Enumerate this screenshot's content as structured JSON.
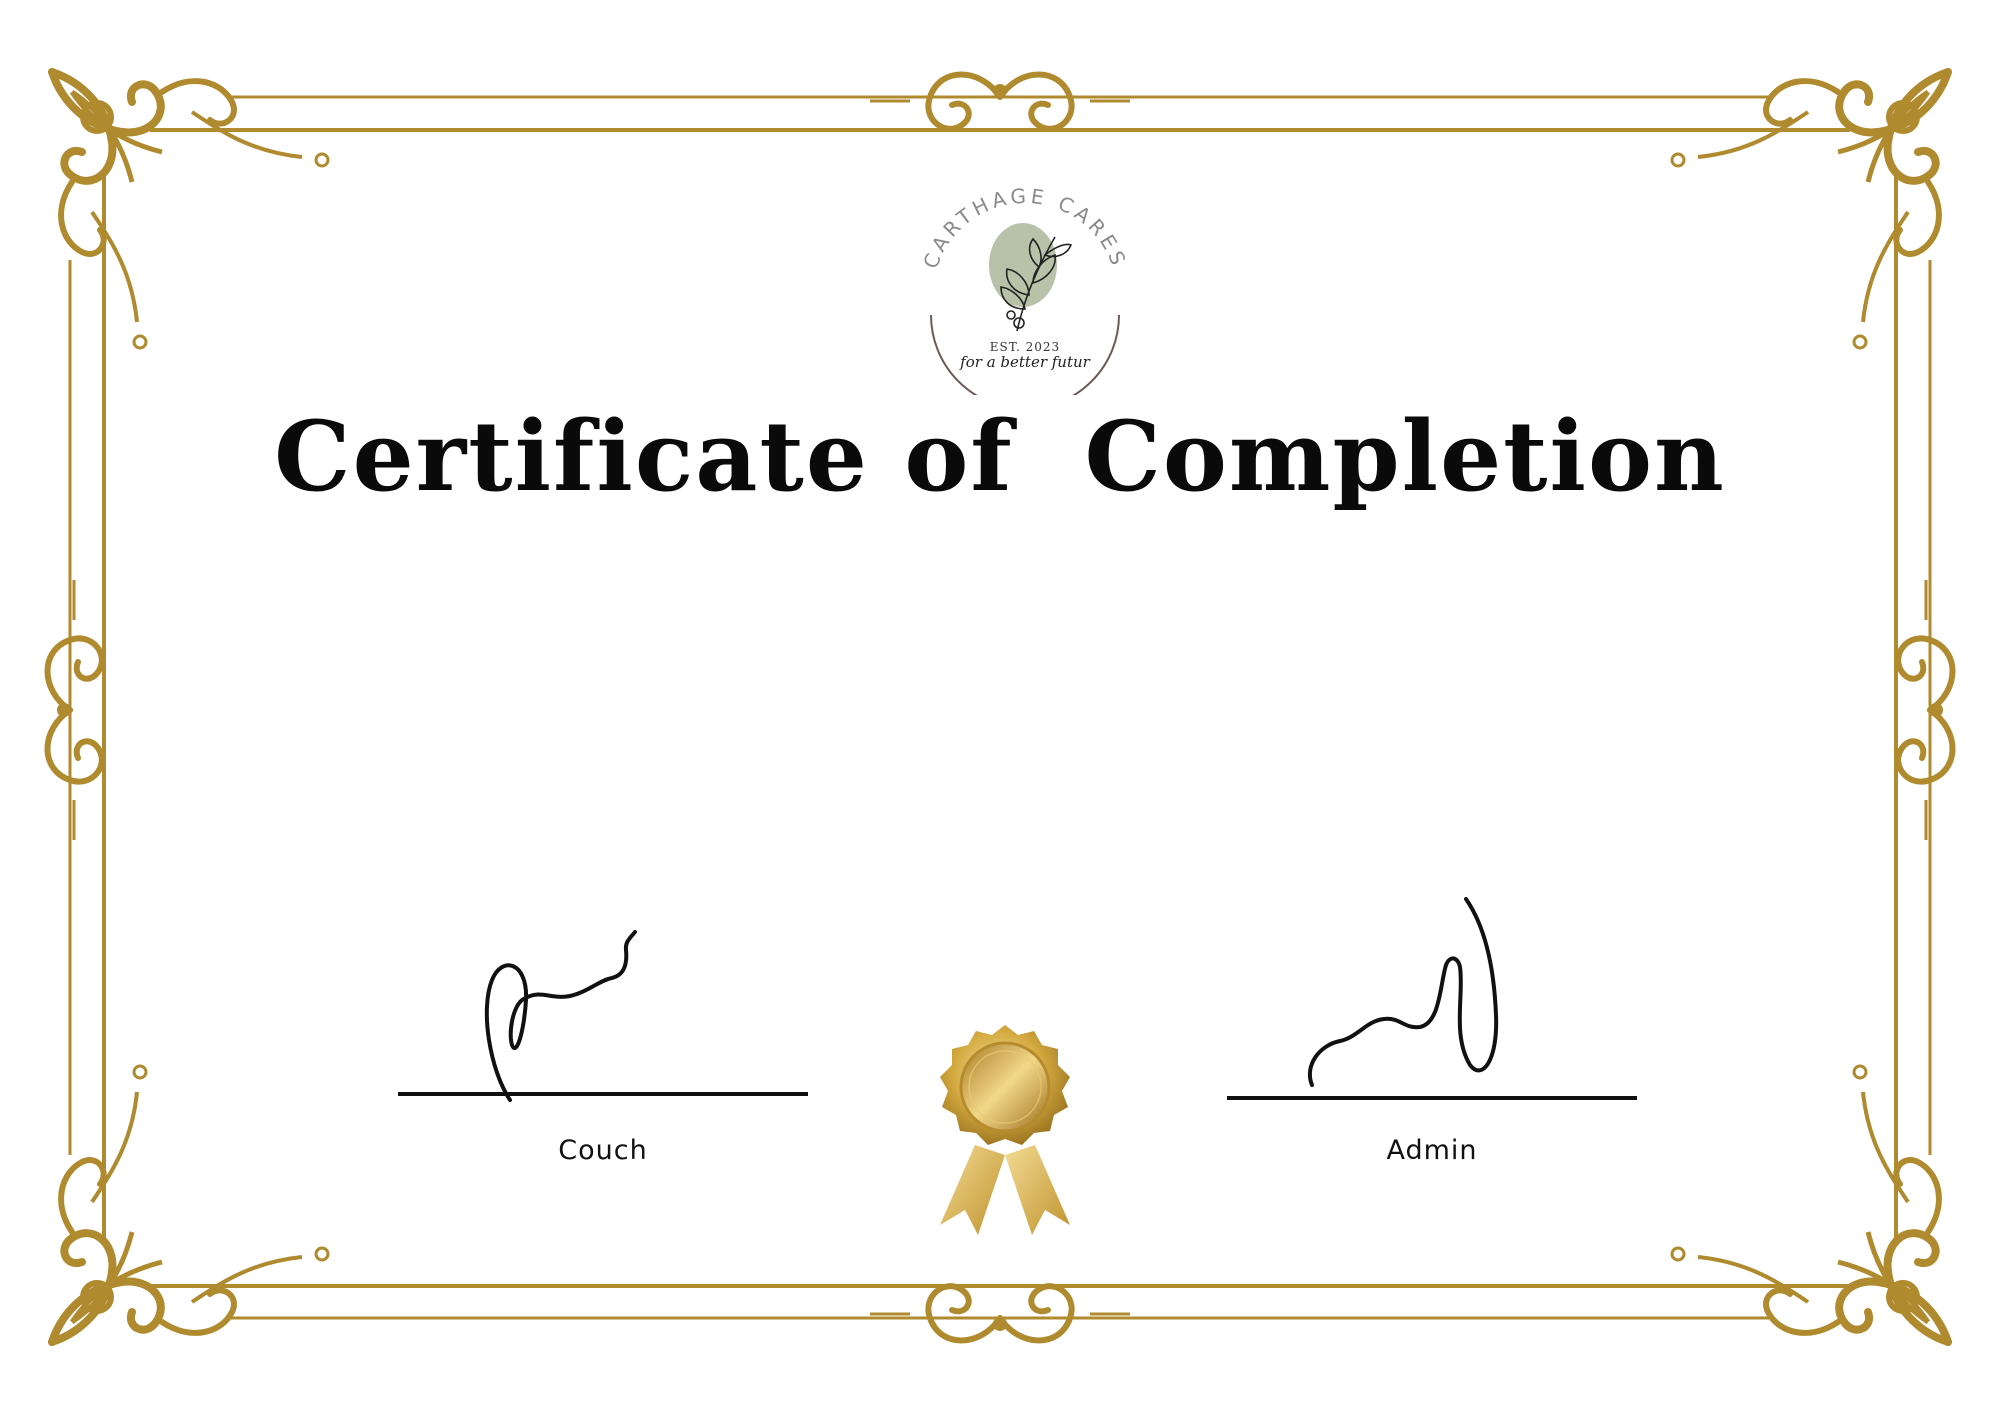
{
  "logo": {
    "org_name": "CARTHAGE CARES",
    "established": "EST. 2023",
    "tagline": "for a better futur"
  },
  "title": "Certificate of  Completion",
  "signatures": {
    "left_label": "Couch",
    "right_label": "Admin"
  },
  "colors": {
    "gold": "#b08a2e",
    "gold_light": "#d9b45a",
    "ink": "#0a0a0a",
    "sage": "#9fae8c"
  }
}
